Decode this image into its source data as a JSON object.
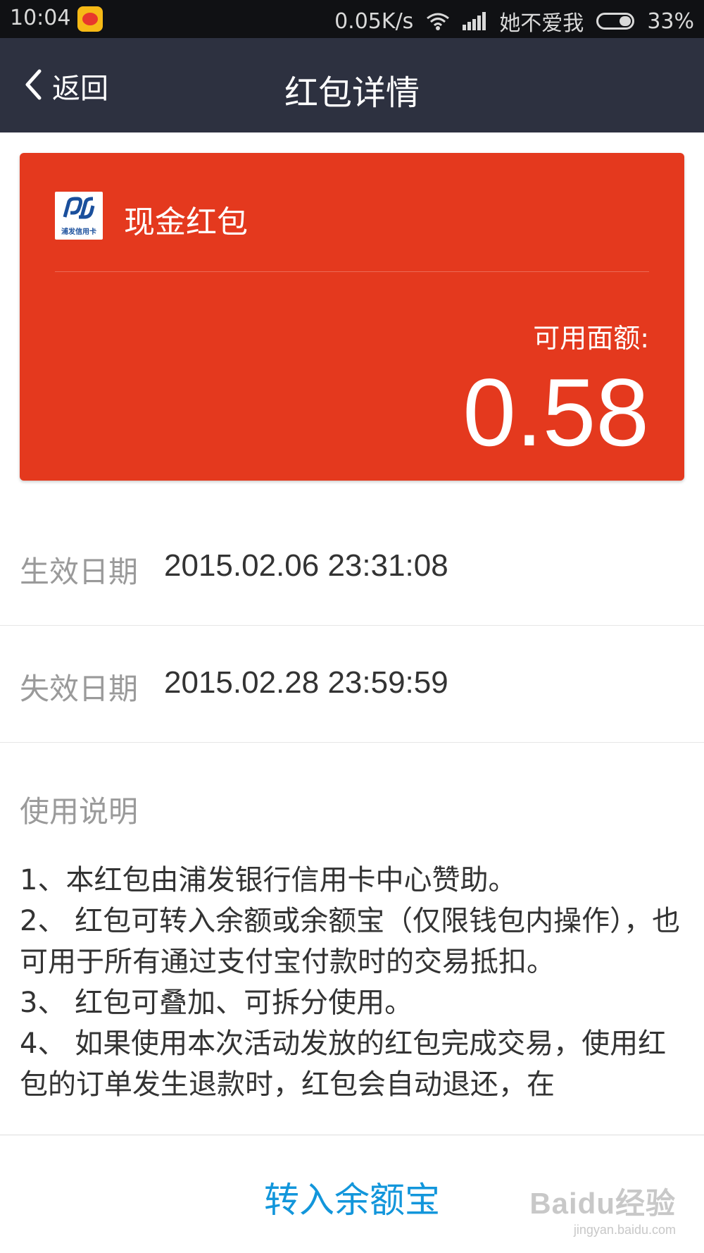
{
  "status_bar": {
    "time": "10:04",
    "network_speed": "0.05K/s",
    "carrier": "她不爱我",
    "battery": "33%",
    "icons": [
      "weibo-icon",
      "wifi-icon",
      "signal-icon",
      "battery-icon"
    ]
  },
  "nav": {
    "back_label": "返回",
    "title": "红包详情"
  },
  "card": {
    "bank_logo_text": "浦发信用卡",
    "title": "现金红包",
    "balance_label": "可用面额:",
    "balance_value": "0.58",
    "color": "#e4391e"
  },
  "dates": [
    {
      "label": "生效日期",
      "value": "2015.02.06 23:31:08"
    },
    {
      "label": "失效日期",
      "value": "2015.02.28 23:59:59"
    }
  ],
  "instructions": {
    "title": "使用说明",
    "items": [
      "1、本红包由浦发银行信用卡中心赞助。",
      "2、 红包可转入余额或余额宝（仅限钱包内操作），也可用于所有通过支付宝付款时的交易抵扣。",
      "3、 红包可叠加、可拆分使用。",
      "4、 如果使用本次活动发放的红包完成交易，使用红包的订单发生退款时，红包会自动退还，在"
    ]
  },
  "bottom_button": {
    "label": "转入余额宝",
    "color": "#1296db"
  },
  "watermark": {
    "brand": "Baidu经验",
    "url": "jingyan.baidu.com"
  }
}
